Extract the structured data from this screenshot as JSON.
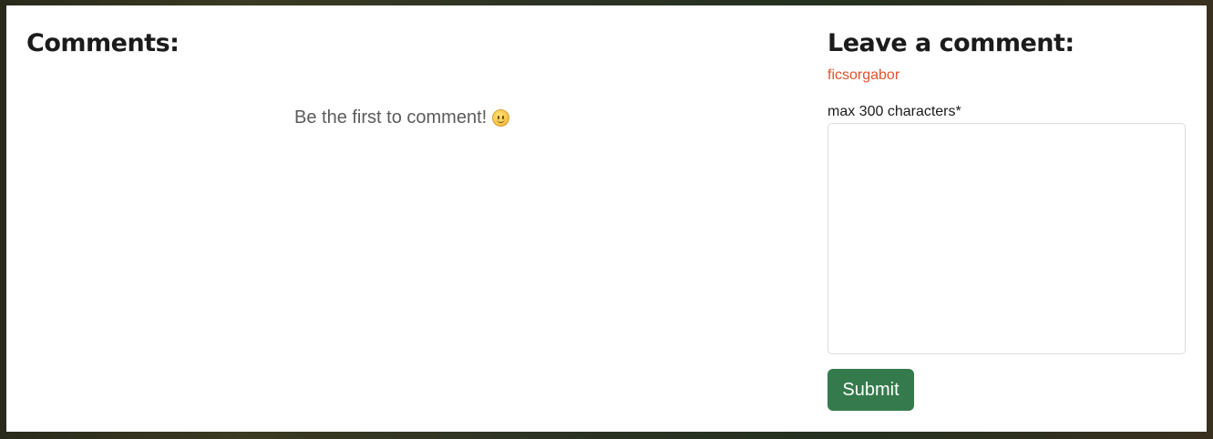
{
  "comments": {
    "title": "Comments:",
    "empty_message": "Be the first to comment!",
    "empty_icon": "slightly-smiling-face-icon"
  },
  "form": {
    "title": "Leave a comment:",
    "username": "ficsorgabor",
    "textarea_label": "max 300 characters*",
    "textarea_value": "",
    "submit_label": "Submit"
  },
  "colors": {
    "accent": "#e0532b",
    "submit_bg": "#357a4c",
    "heading": "#1b1b1b"
  }
}
